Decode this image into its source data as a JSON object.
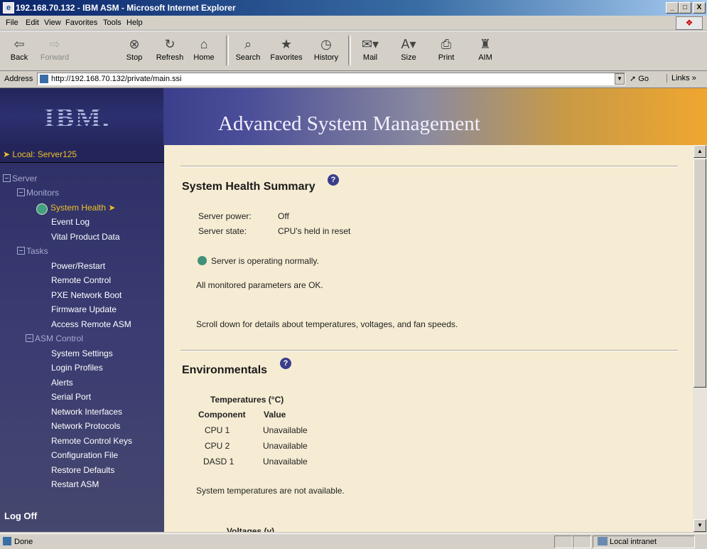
{
  "window": {
    "title": "192.168.70.132 - IBM ASM - Microsoft Internet Explorer",
    "controls": [
      "_",
      "□",
      "X"
    ]
  },
  "menubar": [
    "File",
    "Edit",
    "View",
    "Favorites",
    "Tools",
    "Help"
  ],
  "toolbar": {
    "back": "Back",
    "forward": "Forward",
    "stop": "Stop",
    "refresh": "Refresh",
    "home": "Home",
    "search": "Search",
    "favorites": "Favorites",
    "history": "History",
    "mail": "Mail",
    "size": "Size",
    "print": "Print",
    "aim": "AIM"
  },
  "addressbar": {
    "label": "Address",
    "url": "http://192.168.70.132/private/main.ssi",
    "go": "Go",
    "links": "Links »"
  },
  "banner": {
    "logo": "IBM.",
    "title": "Advanced System Management"
  },
  "sidebar": {
    "local": "➤ Local:  Server125",
    "server": "Server",
    "monitors": "Monitors",
    "system_health": "System Health ➤",
    "event_log": "Event Log",
    "vital_product_data": "Vital Product Data",
    "tasks": "Tasks",
    "power_restart": "Power/Restart",
    "remote_control": "Remote Control",
    "pxe_network_boot": "PXE Network Boot",
    "firmware_update": "Firmware Update",
    "access_remote_asm": "Access Remote ASM",
    "asm_control": "ASM Control",
    "system_settings": "System Settings",
    "login_profiles": "Login Profiles",
    "alerts": "Alerts",
    "serial_port": "Serial Port",
    "network_interfaces": "Network Interfaces",
    "network_protocols": "Network Protocols",
    "remote_control_keys": "Remote Control Keys",
    "configuration_file": "Configuration File",
    "restore_defaults": "Restore Defaults",
    "restart_asm": "Restart ASM",
    "log_off": "Log Off"
  },
  "main": {
    "health_title": "System Health Summary",
    "power_label": "Server power:",
    "power_value": "Off",
    "state_label": "Server state:",
    "state_value": "CPU's held in reset",
    "status_msg": "Server is operating normally.",
    "params_msg": "All monitored parameters are OK.",
    "scroll_msg": "Scroll down for details about temperatures, voltages, and fan speeds.",
    "env_title": "Environmentals",
    "temp_title": "Temperatures (°C)",
    "col_component": "Component",
    "col_value": "Value",
    "temps": [
      {
        "component": "CPU 1",
        "value": "Unavailable"
      },
      {
        "component": "CPU 2",
        "value": "Unavailable"
      },
      {
        "component": "DASD 1",
        "value": "Unavailable"
      }
    ],
    "temp_note": "System temperatures are not available.",
    "voltages_title": "Voltages (v)"
  },
  "statusbar": {
    "status": "Done",
    "zone": "Local intranet"
  },
  "colors": {
    "sidebar_bg": "#3a3c72",
    "content_bg": "#f5ecd3",
    "active_link": "#f0c028",
    "status_ok": "#43907a"
  }
}
